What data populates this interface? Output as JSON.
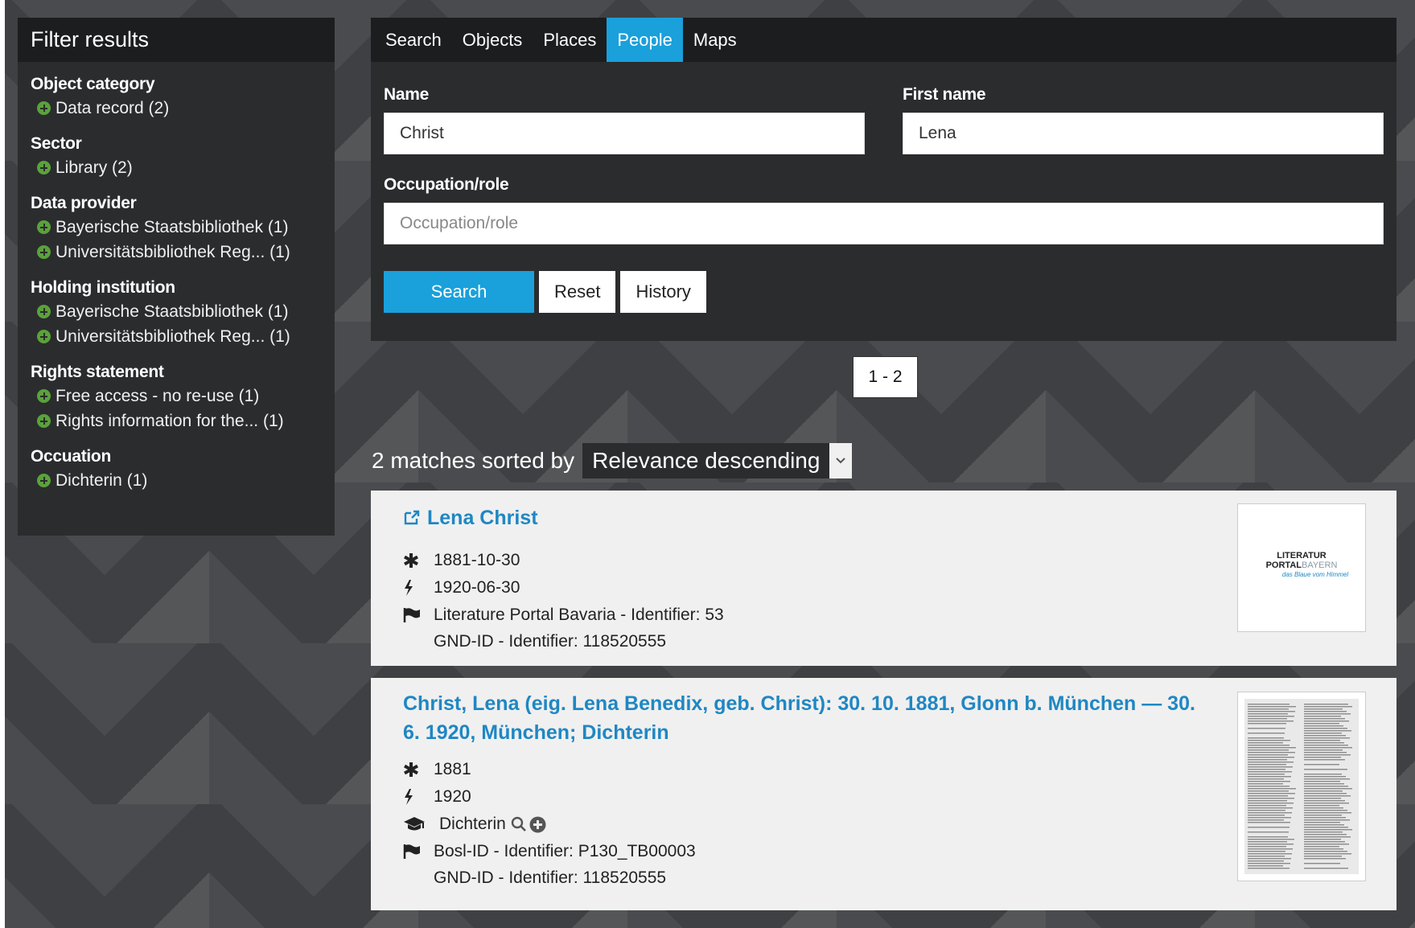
{
  "sidebar": {
    "title": "Filter results",
    "facets": [
      {
        "title": "Object category",
        "items": [
          "Data record (2)"
        ]
      },
      {
        "title": "Sector",
        "items": [
          "Library (2)"
        ]
      },
      {
        "title": "Data provider",
        "items": [
          "Bayerische Staatsbibliothek (1)",
          "Universitätsbibliothek Reg... (1)"
        ]
      },
      {
        "title": "Holding institution",
        "items": [
          "Bayerische Staatsbibliothek (1)",
          "Universitätsbibliothek Reg... (1)"
        ]
      },
      {
        "title": "Rights statement",
        "items": [
          "Free access - no re-use (1)",
          "Rights information for the... (1)"
        ]
      },
      {
        "title": "Occuation",
        "items": [
          "Dichterin (1)"
        ]
      }
    ]
  },
  "tabs": [
    "Search",
    "Objects",
    "Places",
    "People",
    "Maps"
  ],
  "active_tab": "People",
  "form": {
    "name_label": "Name",
    "name_value": "Christ",
    "first_name_label": "First name",
    "first_name_value": "Lena",
    "occupation_label": "Occupation/role",
    "occupation_value": "",
    "occupation_placeholder": "Occupation/role",
    "search_label": "Search",
    "reset_label": "Reset",
    "history_label": "History"
  },
  "pager": "1 - 2",
  "sort": {
    "prefix": "2 matches sorted by",
    "value": "Relevance descending"
  },
  "results": [
    {
      "title": "Lena Christ",
      "birth": "1881-10-30",
      "death": "1920-06-30",
      "source": "Literature Portal Bavaria - Identifier: 53",
      "source2": "GND-ID - Identifier: 118520555",
      "thumb_lines": [
        "LITERATUR",
        "PORTAL",
        "BAYERN",
        "das Blaue vom Himmel"
      ]
    },
    {
      "title": "Christ, Lena (eig. Lena Benedix, geb. Christ): 30. 10. 1881, Glonn b. München — 30. 6. 1920, München; Dichterin",
      "birth": "1881",
      "death": "1920",
      "occupation": "Dichterin",
      "source": "Bosl-ID - Identifier: P130_TB00003",
      "source2": "GND-ID - Identifier: 118520555"
    }
  ],
  "colors": {
    "accent": "#1aa0db",
    "link": "#1f87c3",
    "facet_plus": "#5aa23a"
  },
  "icons": {
    "birth": "asterisk-icon",
    "death": "lightning-icon",
    "occupation": "graduation-cap-icon",
    "source": "flag-icon",
    "external": "external-link-icon"
  }
}
